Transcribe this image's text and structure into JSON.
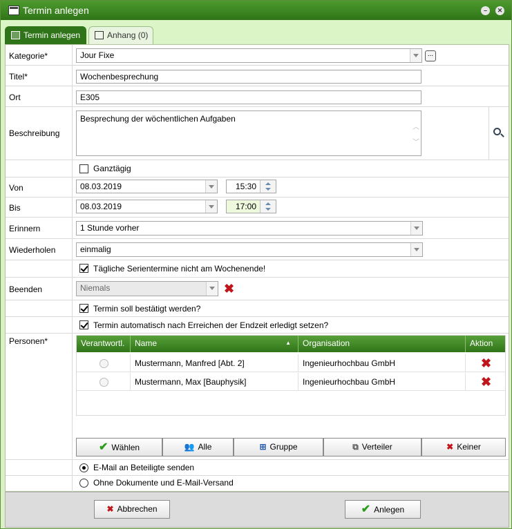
{
  "window": {
    "title": "Termin anlegen"
  },
  "tabs": [
    {
      "label": "Termin anlegen"
    },
    {
      "label": "Anhang (0)"
    }
  ],
  "form": {
    "kategorie": {
      "label": "Kategorie*",
      "value": "Jour Fixe"
    },
    "titel": {
      "label": "Titel*",
      "value": "Wochenbesprechung"
    },
    "ort": {
      "label": "Ort",
      "value": "E305"
    },
    "beschreibung": {
      "label": "Beschreibung",
      "value": "Besprechung der wöchentlichen Aufgaben"
    },
    "ganztaegig": {
      "label": "Ganztägig",
      "checked": false
    },
    "von": {
      "label": "Von",
      "date": "08.03.2019",
      "time": "15:30"
    },
    "bis": {
      "label": "Bis",
      "date": "08.03.2019",
      "time": "17:00"
    },
    "erinnern": {
      "label": "Erinnern",
      "value": "1 Stunde vorher"
    },
    "wiederholen": {
      "label": "Wiederholen",
      "value": "einmalig"
    },
    "wochenende": {
      "label": "Tägliche Serientermine nicht am Wochenende!",
      "checked": true
    },
    "beenden": {
      "label": "Beenden",
      "value": "Niemals"
    },
    "bestaetigt": {
      "label": "Termin soll bestätigt werden?",
      "checked": true
    },
    "erledigt": {
      "label": "Termin automatisch nach Erreichen der Endzeit erledigt setzen?",
      "checked": true
    },
    "personen": {
      "label": "Personen*",
      "columns": [
        "Verantwortl.",
        "Name",
        "Organisation",
        "Aktion"
      ],
      "rows": [
        {
          "name": "Mustermann, Manfred [Abt. 2]",
          "organisation": "Ingenieurhochbau GmbH"
        },
        {
          "name": "Mustermann, Max [Bauphysik]",
          "organisation": "Ingenieurhochbau GmbH"
        }
      ],
      "buttons": [
        "Wählen",
        "Alle",
        "Gruppe",
        "Verteiler",
        "Keiner"
      ]
    },
    "email_option": {
      "label": "E-Mail an Beteiligte senden",
      "selected": true
    },
    "no_email_option": {
      "label": "Ohne Dokumente und E-Mail-Versand",
      "selected": false
    }
  },
  "footer": {
    "cancel_label": "Abbrechen",
    "create_label": "Anlegen"
  },
  "colors": {
    "brand_green": "#2f7418",
    "delete_red": "#c0151b",
    "check_green": "#2b9c1c"
  }
}
